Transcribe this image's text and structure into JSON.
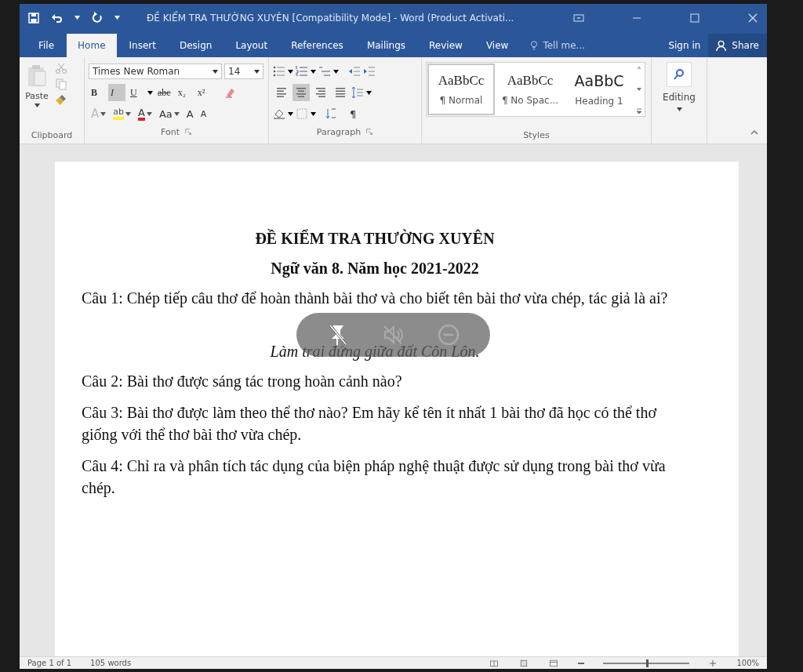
{
  "window": {
    "title": "ĐỀ KIỂM TRA THƯỜNG XUYÊN [Compatibility Mode] - Word (Product Activati..."
  },
  "tabs": [
    {
      "label": "File",
      "selected": false
    },
    {
      "label": "Home",
      "selected": true
    },
    {
      "label": "Insert",
      "selected": false
    },
    {
      "label": "Design",
      "selected": false
    },
    {
      "label": "Layout",
      "selected": false
    },
    {
      "label": "References",
      "selected": false
    },
    {
      "label": "Mailings",
      "selected": false
    },
    {
      "label": "Review",
      "selected": false
    },
    {
      "label": "View",
      "selected": false
    }
  ],
  "tell_me": {
    "placeholder": "Tell me..."
  },
  "sign_in": "Sign in",
  "share": "Share",
  "ribbon": {
    "clipboard": {
      "paste": "Paste",
      "label": "Clipboard"
    },
    "font": {
      "name": "Times New Roman",
      "size": "14",
      "label": "Font",
      "format_buttons": [
        {
          "label": "B",
          "kind": "bold",
          "selected": false
        },
        {
          "label": "I",
          "kind": "italic",
          "selected": true
        },
        {
          "label": "U",
          "kind": "underline",
          "selected": false
        },
        {
          "label": "abc",
          "kind": "strike",
          "selected": false
        },
        {
          "label": "x₂",
          "kind": "plain",
          "selected": false
        },
        {
          "label": "x²",
          "kind": "plain",
          "selected": false
        }
      ],
      "row2": [
        {
          "label": "A",
          "kind": "effects"
        },
        {
          "label": "ab",
          "kind": "highlight"
        },
        {
          "label": "A",
          "kind": "color"
        },
        {
          "label": "Aa",
          "kind": "case"
        },
        {
          "label": "A",
          "kind": "grow"
        },
        {
          "label": "A",
          "kind": "shrink"
        }
      ]
    },
    "paragraph": {
      "label": "Paragraph",
      "pilcrow": "¶",
      "alignments": [
        {
          "kind": "left",
          "selected": false
        },
        {
          "kind": "center",
          "selected": true
        },
        {
          "kind": "right",
          "selected": false
        },
        {
          "kind": "justify",
          "selected": false
        }
      ]
    },
    "styles": {
      "label": "Styles",
      "items": [
        {
          "sample": "AaBbCc",
          "name": "¶ Normal",
          "kind": "normal",
          "selected": true
        },
        {
          "sample": "AaBbCc",
          "name": "¶ No Spac...",
          "kind": "normal",
          "selected": false
        },
        {
          "sample": "AaBbC",
          "name": "Heading 1",
          "kind": "heading",
          "selected": false
        }
      ]
    },
    "editing": {
      "label": "Editing"
    }
  },
  "document": {
    "paragraphs": [
      {
        "kind": "title",
        "text": "ĐỀ KIỂM TRA THƯỜNG XUYÊN"
      },
      {
        "kind": "title",
        "text": "Ngữ văn 8. Năm học 2021-2022"
      },
      {
        "kind": "body",
        "text": "Câu 1: Chép tiếp câu thơ để hoàn thành bài thơ và cho biết tên bài thơ vừa chép, tác giả là ai?"
      },
      {
        "kind": "verse",
        "text": "Làm trai đứng giữa đất Côn Lôn."
      },
      {
        "kind": "body",
        "text": "Câu 2: Bài thơ được sáng tác trong hoàn cảnh nào?"
      },
      {
        "kind": "body",
        "text": "Câu 3: Bài thơ được làm theo thể thơ nào? Em hãy kể tên ít nhất 1 bài thơ đã học có thể thơ giống với thể thơ bài thơ vừa chép."
      },
      {
        "kind": "body",
        "text": "Câu 4: Chỉ ra và phân tích tác dụng của biện pháp nghệ thuật được sử dụng trong bài thơ vừa chép."
      }
    ]
  },
  "status_bar": {
    "page": "Page 1 of 1",
    "words": "105 words",
    "zoom": "100%",
    "zoom_slider": {
      "level": 0.5
    }
  }
}
